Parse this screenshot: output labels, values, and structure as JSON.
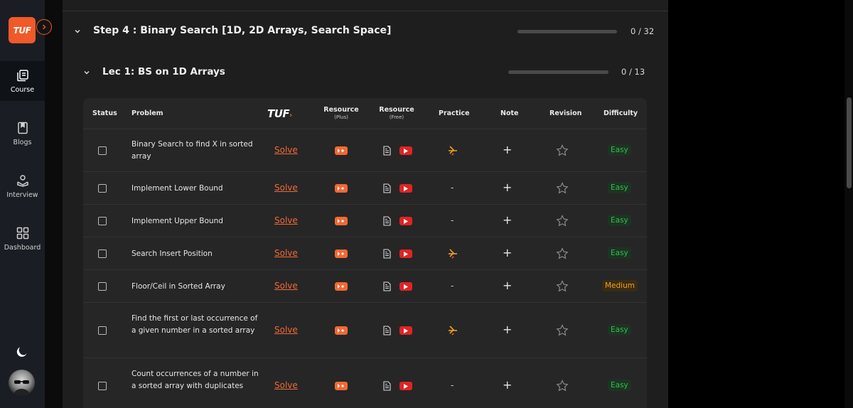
{
  "sidebar": {
    "logo_text": "TUF",
    "items": [
      {
        "label": "Course",
        "icon": "course-icon",
        "active": true
      },
      {
        "label": "Blogs",
        "icon": "bookmark-icon",
        "active": false
      },
      {
        "label": "Interview",
        "icon": "interview-icon",
        "active": false
      },
      {
        "label": "Dashboard",
        "icon": "dashboard-icon",
        "active": false
      }
    ]
  },
  "step": {
    "title": "Step 4 : Binary Search [1D, 2D Arrays, Search Space]",
    "progress_text": "0 / 32",
    "progress": 0
  },
  "lecture": {
    "title": "Lec 1: BS on 1D Arrays",
    "progress_text": "0 / 13",
    "progress": 0
  },
  "table": {
    "headers": {
      "status": "Status",
      "problem": "Problem",
      "tuf": "TUF",
      "resource_plus": "Resource",
      "resource_plus_sub": "(Plus)",
      "resource_free": "Resource",
      "resource_free_sub": "(Free)",
      "practice": "Practice",
      "note": "Note",
      "revision": "Revision",
      "difficulty": "Difficulty"
    },
    "solve_label": "Solve",
    "rows": [
      {
        "problem": "Binary Search to find X in sorted array",
        "practice": "icon",
        "difficulty": "Easy"
      },
      {
        "problem": "Implement Lower Bound",
        "practice": "-",
        "difficulty": "Easy"
      },
      {
        "problem": "Implement Upper Bound",
        "practice": "-",
        "difficulty": "Easy"
      },
      {
        "problem": "Search Insert Position",
        "practice": "icon",
        "difficulty": "Easy"
      },
      {
        "problem": "Floor/Ceil in Sorted Array",
        "practice": "-",
        "difficulty": "Medium"
      },
      {
        "problem": "Find the first or last occurrence of a given number in a sorted array",
        "practice": "icon",
        "difficulty": "Easy"
      },
      {
        "problem": "Count occurrences of a number in a sorted array with duplicates",
        "practice": "-",
        "difficulty": "Easy"
      }
    ],
    "note_symbol": "+"
  },
  "colors": {
    "accent": "#f05a28",
    "easy": "#2ec04a",
    "medium": "#f0a020",
    "youtube": "#e02424"
  }
}
